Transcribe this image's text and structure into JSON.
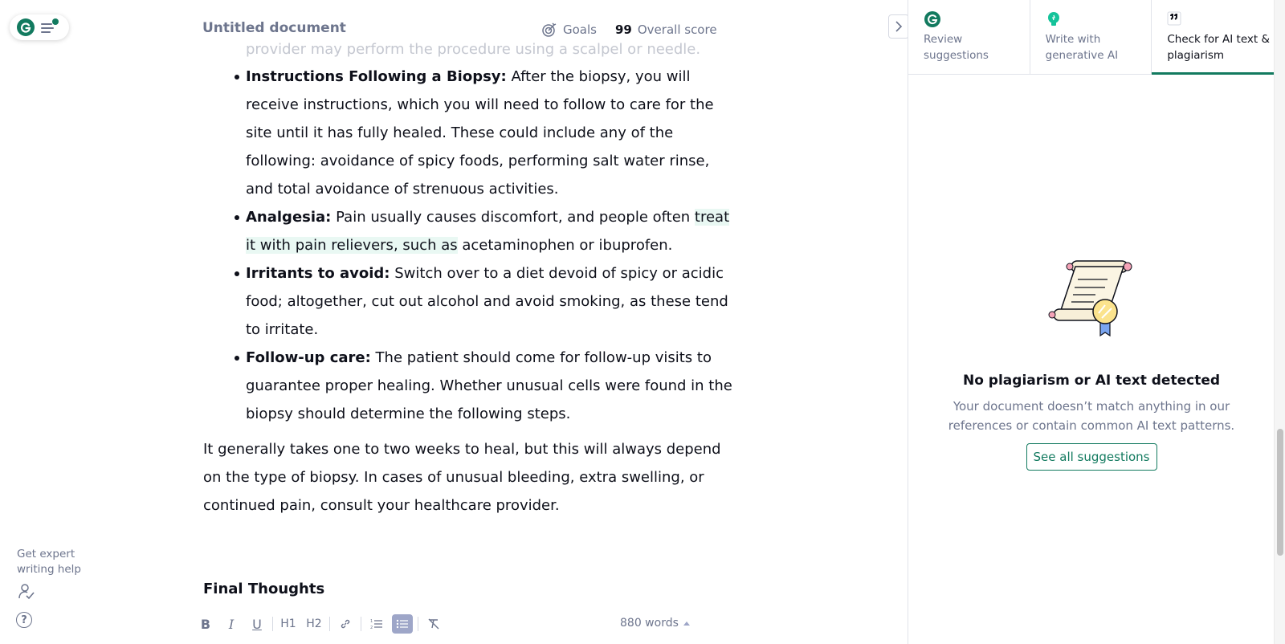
{
  "header": {
    "doc_title": "Untitled document",
    "goals_label": "Goals",
    "score_value": "99",
    "score_label": "Overall score"
  },
  "document": {
    "faded_line": "provider may perform the procedure using a scalpel or needle.",
    "bullets": [
      {
        "bold": "Instructions Following a Biopsy:",
        "text": " After the biopsy, you will receive instructions, which you will need to follow to care for the site until it has fully healed. These could include any of the following: avoidance of spicy foods, performing salt water rinse, and total avoidance of strenuous activities."
      },
      {
        "bold": "Analgesia:",
        "text_before": " Pain usually causes discomfort, and people often ",
        "highlight": "treat it with pain relievers, such as",
        "text_after": " acetaminophen or ibuprofen."
      },
      {
        "bold": "Irritants to avoid:",
        "text": " Switch over to a diet devoid of spicy or acidic food; altogether, cut out alcohol and avoid smoking, as these tend to irritate."
      },
      {
        "bold": "Follow-up care:",
        "text": " The patient should come for follow-up visits to guarantee proper healing. Whether unusual cells were found in the biopsy should determine the following steps."
      }
    ],
    "paragraph": "It generally takes one to two weeks to heal, but this will always depend on the type of biopsy. In cases of unusual bleeding, extra swelling, or continued pain, consult your healthcare provider.",
    "heading": "Final Thoughts"
  },
  "toolbar": {
    "bold": "B",
    "italic": "I",
    "underline": "U",
    "h1": "H1",
    "h2": "H2",
    "word_count": "880 words"
  },
  "left": {
    "expert_help": "Get expert writing help",
    "help": "?"
  },
  "panel": {
    "tabs": [
      {
        "label": "Review suggestions"
      },
      {
        "label": "Write with generative AI"
      },
      {
        "label": "Check for AI text & plagiarism"
      }
    ],
    "empty_title": "No plagiarism or AI text detected",
    "empty_desc": "Your document doesn’t match anything in our references or contain common AI text patterns.",
    "see_all": "See all suggestions"
  },
  "colors": {
    "brand": "#127a5f",
    "highlight": "#e9f8f3",
    "muted": "#6d758d"
  }
}
